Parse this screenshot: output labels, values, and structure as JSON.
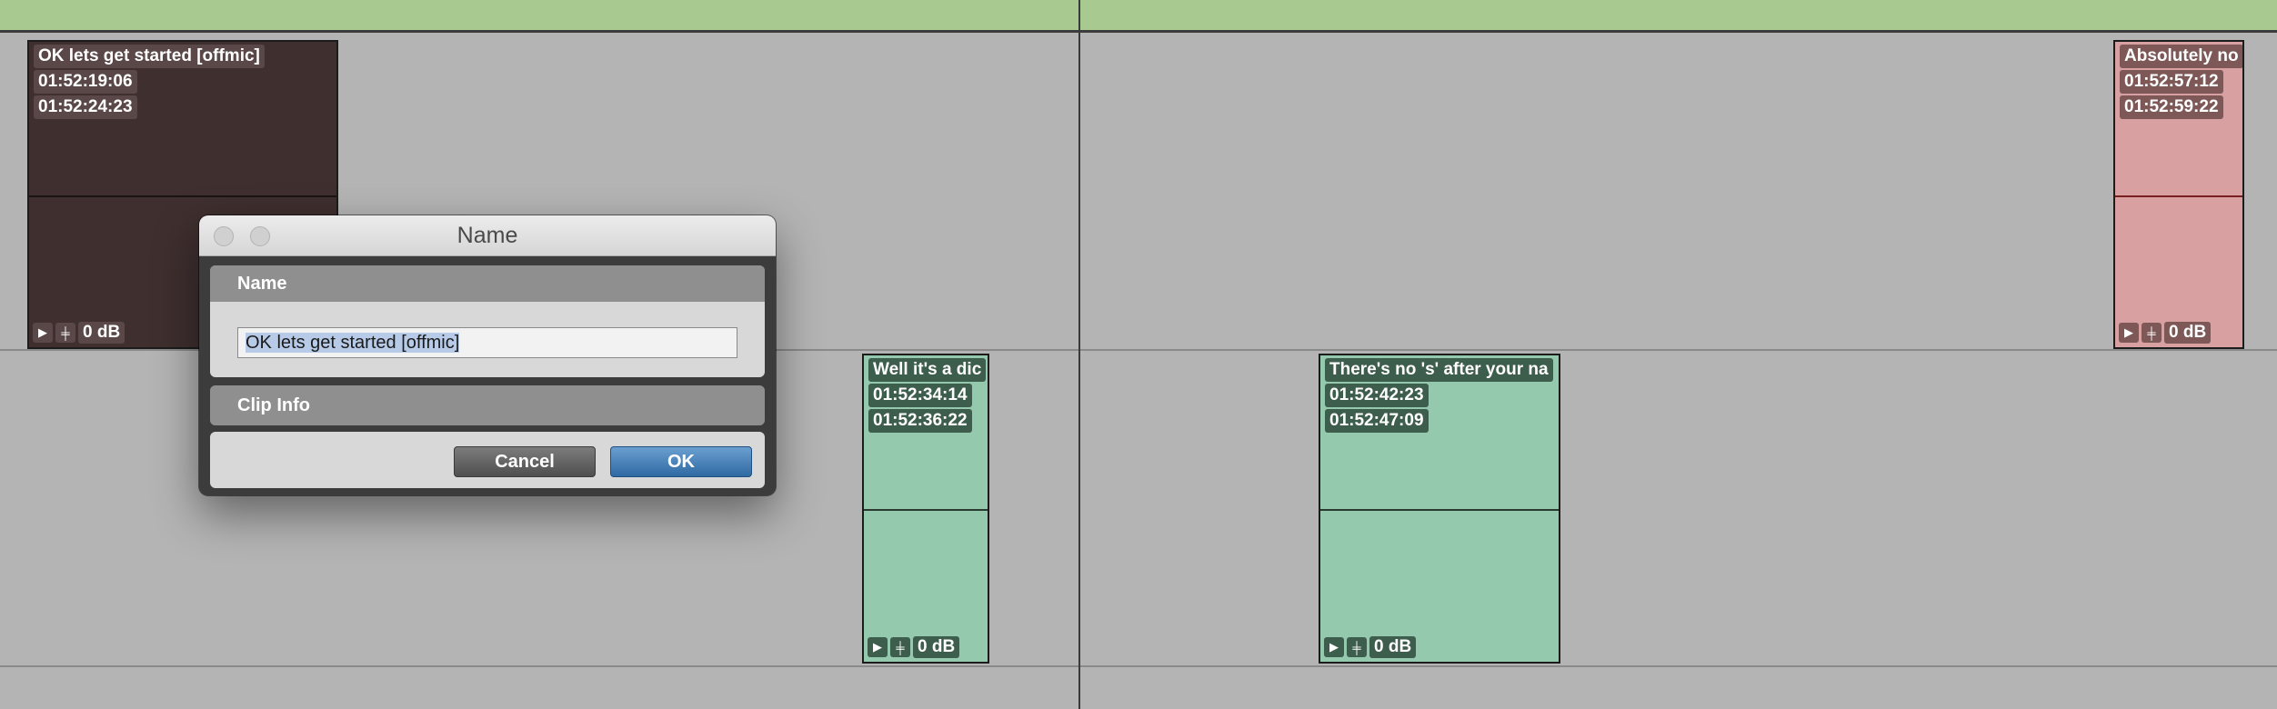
{
  "clips": {
    "c1": {
      "name": "OK lets get started [offmic]",
      "start": "01:52:19:06",
      "end": "01:52:24:23",
      "gain": "0 dB"
    },
    "c2": {
      "name": "Well it's a dic",
      "start": "01:52:34:14",
      "end": "01:52:36:22",
      "gain": "0 dB"
    },
    "c3": {
      "name": "There's no 's' after your na",
      "start": "01:52:42:23",
      "end": "01:52:47:09",
      "gain": "0 dB"
    },
    "c4": {
      "name": "Absolutely no",
      "start": "01:52:57:12",
      "end": "01:52:59:22",
      "gain": "0 dB"
    }
  },
  "colors": {
    "dark_clip": "#3f2f2f",
    "green_clip": "#95c9ae",
    "pink_clip": "#d8a0a0",
    "ruler": "#a8c98f"
  },
  "dialog": {
    "title": "Name",
    "name_section": "Name",
    "name_value": "OK lets get started [offmic]",
    "clip_info": "Clip Info",
    "cancel": "Cancel",
    "ok": "OK"
  }
}
